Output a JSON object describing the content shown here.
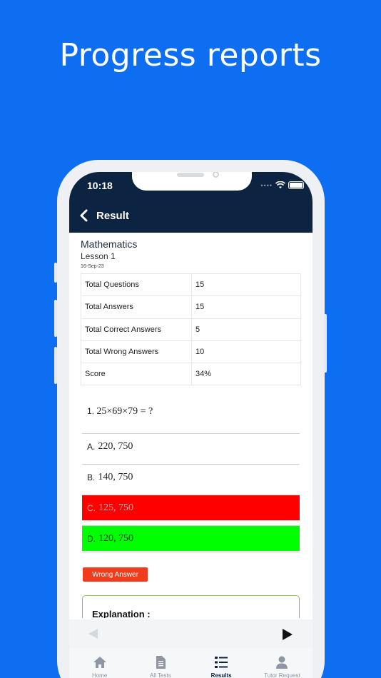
{
  "headline": "Progress reports",
  "status_bar": {
    "time": "10:18"
  },
  "header": {
    "title": "Result"
  },
  "test": {
    "subject": "Mathematics",
    "lesson": "Lesson  1",
    "date": "16-Sep-23"
  },
  "summary": [
    {
      "label": "Total Questions",
      "value": "15"
    },
    {
      "label": "Total Answers",
      "value": "15"
    },
    {
      "label": "Total Correct Answers",
      "value": "5"
    },
    {
      "label": "Total Wrong Answers",
      "value": "10"
    },
    {
      "label": "Score",
      "value": "34%"
    }
  ],
  "question": {
    "number": "1.",
    "text": "25×69×79 = ?"
  },
  "options": [
    {
      "letter": "A.",
      "text": "220, 750",
      "state": "neutral"
    },
    {
      "letter": "B.",
      "text": "140, 750",
      "state": "neutral"
    },
    {
      "letter": "C.",
      "text": "125, 750",
      "state": "selected-wrong"
    },
    {
      "letter": "D.",
      "text": "120, 750",
      "state": "correct"
    }
  ],
  "result_badge": "Wrong Answer",
  "explanation": {
    "title": "Explanation :"
  },
  "tabs": [
    {
      "label": "Home",
      "icon": "home-icon",
      "active": false
    },
    {
      "label": "All Tests",
      "icon": "document-icon",
      "active": false
    },
    {
      "label": "Results",
      "icon": "list-icon",
      "active": true
    },
    {
      "label": "Tutor Request",
      "icon": "person-icon",
      "active": false
    }
  ],
  "colors": {
    "background": "#0d6ef2",
    "header": "#0d2342",
    "wrong": "#ff0000",
    "correct": "#00ff00",
    "badge": "#f03c1d",
    "explanation_border": "#8bc34a"
  }
}
